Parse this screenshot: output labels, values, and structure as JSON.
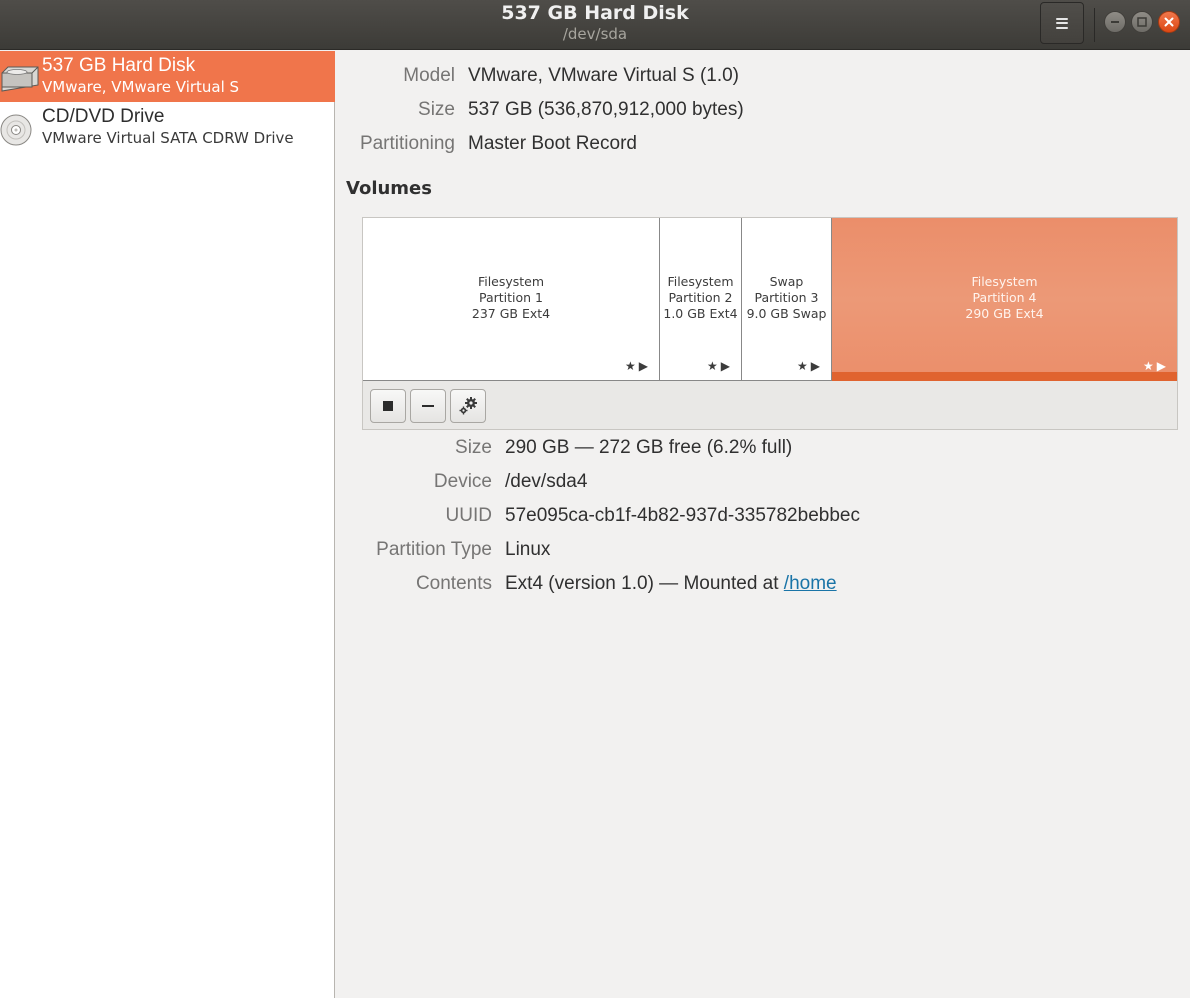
{
  "header": {
    "title": "537 GB Hard Disk",
    "subtitle": "/dev/sda"
  },
  "sidebar": {
    "drives": [
      {
        "name": "537 GB Hard Disk",
        "description": "VMware, VMware Virtual S",
        "icon": "hard-disk-icon",
        "selected": true
      },
      {
        "name": "CD/DVD Drive",
        "description": "VMware Virtual SATA CDRW Drive",
        "icon": "optical-drive-icon",
        "selected": false
      }
    ]
  },
  "disk_info": {
    "model_label": "Model",
    "model_value": "VMware, VMware Virtual S (1.0)",
    "size_label": "Size",
    "size_value": "537 GB (536,870,912,000 bytes)",
    "partitioning_label": "Partitioning",
    "partitioning_value": "Master Boot Record"
  },
  "volumes": {
    "heading": "Volumes",
    "partitions": [
      {
        "line1": "Filesystem",
        "line2": "Partition 1",
        "line3": "237 GB Ext4",
        "selected": false
      },
      {
        "line1": "Filesystem",
        "line2": "Partition 2",
        "line3": "1.0 GB Ext4",
        "selected": false
      },
      {
        "line1": "Swap",
        "line2": "Partition 3",
        "line3": "9.0 GB Swap",
        "selected": false
      },
      {
        "line1": "Filesystem",
        "line2": "Partition 4",
        "line3": "290 GB Ext4",
        "selected": true
      }
    ],
    "toolbar_icons": [
      "stop-icon",
      "minus-icon",
      "gears-icon"
    ]
  },
  "partition_details": {
    "size_label": "Size",
    "size_value": "290 GB — 272 GB free (6.2% full)",
    "device_label": "Device",
    "device_value": "/dev/sda4",
    "uuid_label": "UUID",
    "uuid_value": "57e095ca-cb1f-4b82-937d-335782bebbec",
    "type_label": "Partition Type",
    "type_value": "Linux",
    "contents_label": "Contents",
    "contents_prefix": "Ext4 (version 1.0) — Mounted at ",
    "contents_link": "/home"
  },
  "colors": {
    "accent": "#f0754b",
    "selected_partition": "#eb8e6a",
    "usage_bar": "#e0632f",
    "link": "#1a74a7"
  }
}
